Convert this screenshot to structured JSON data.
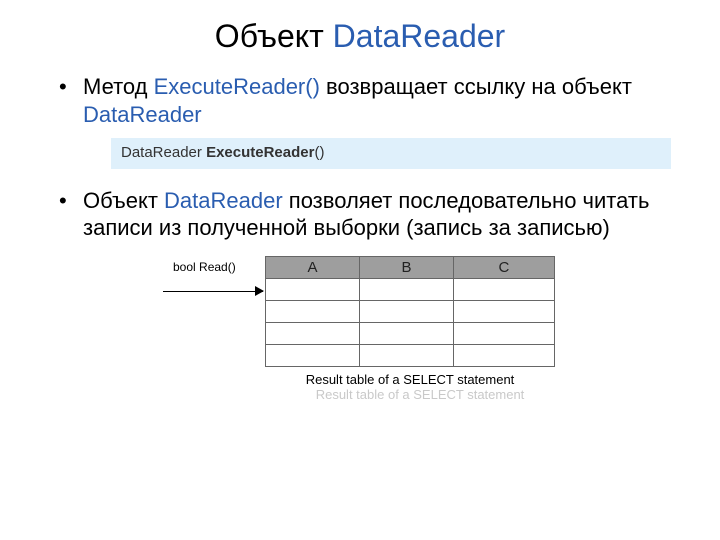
{
  "title": {
    "part1": "Объект ",
    "part2": "DataReader"
  },
  "bullet1": {
    "t1": "Метод ",
    "t2": "ExecuteReader()",
    "t3": " возвращает ссылку на объект ",
    "t4": "DataReader"
  },
  "codebar": {
    "ret": "DataReader ",
    "name": "ExecuteReader",
    "paren": "()"
  },
  "bullet2": {
    "t1": "Объект ",
    "t2": "DataReader",
    "t3": " позволяет последовательно читать записи из полученной выборки (запись за записью)"
  },
  "diagram": {
    "read_label": "bool Read()",
    "headers": [
      "A",
      "B",
      "C"
    ],
    "caption": "Result table of a SELECT statement",
    "caption_ghost": "Result table of a SELECT statement"
  }
}
